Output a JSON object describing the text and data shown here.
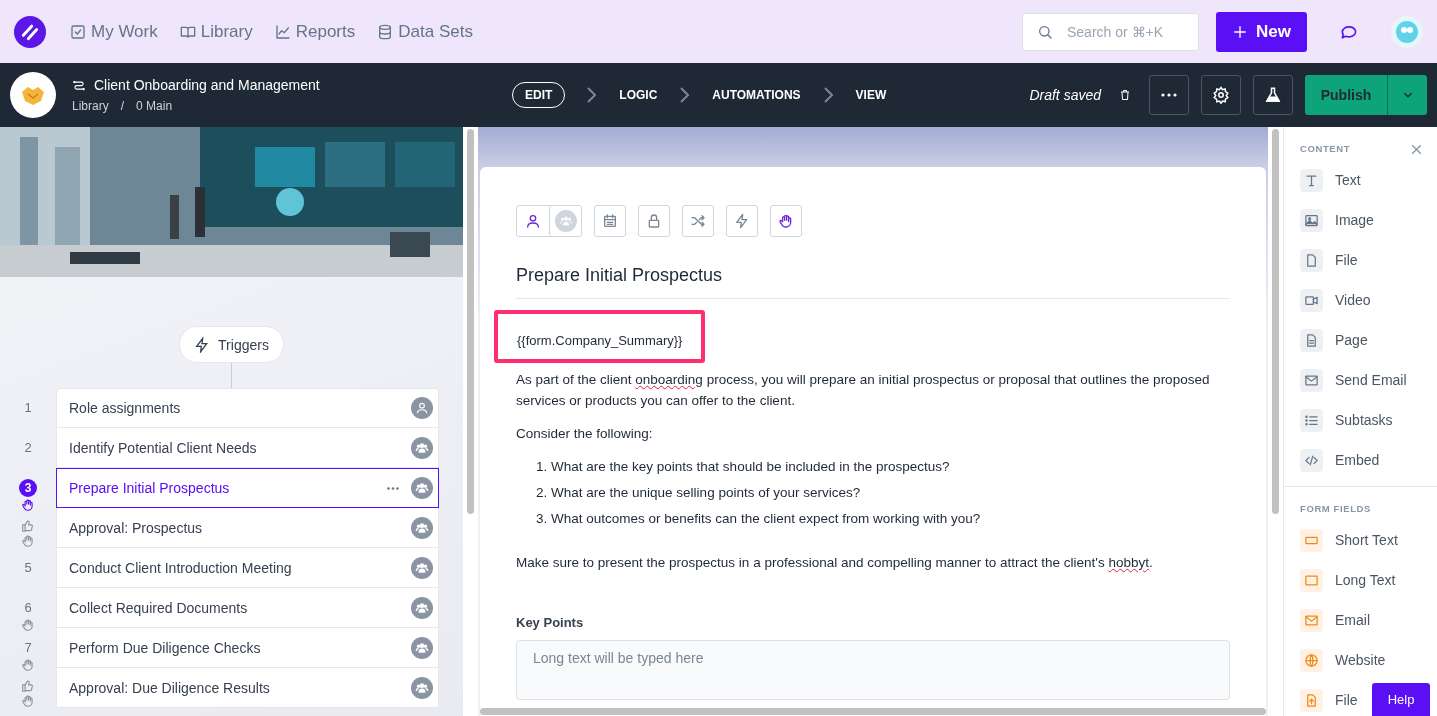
{
  "top_nav": {
    "items": [
      {
        "label": "My Work"
      },
      {
        "label": "Library"
      },
      {
        "label": "Reports"
      },
      {
        "label": "Data Sets"
      }
    ],
    "search": {
      "placeholder": "Search or ⌘+K"
    },
    "new_button": "New"
  },
  "workflow_bar": {
    "title": "Client Onboarding and Management",
    "breadcrumb": [
      "Library",
      "/",
      "0 Main"
    ],
    "steps": [
      {
        "label": "EDIT",
        "selected": true
      },
      {
        "label": "LOGIC",
        "selected": false
      },
      {
        "label": "AUTOMATIONS",
        "selected": false
      },
      {
        "label": "VIEW",
        "selected": false
      }
    ],
    "status": "Draft saved",
    "publish": "Publish"
  },
  "left_panel": {
    "triggers": "Triggers",
    "tasks": [
      {
        "number": "1",
        "kind": "task",
        "stop": false,
        "title": "Role assignments",
        "group": false,
        "selected": false
      },
      {
        "number": "2",
        "kind": "task",
        "stop": false,
        "title": "Identify Potential Client Needs",
        "group": true,
        "selected": false
      },
      {
        "number": "3",
        "kind": "task",
        "stop": true,
        "title": "Prepare Initial Prospectus",
        "group": true,
        "selected": true
      },
      {
        "kind": "approval",
        "stop": true,
        "title": "Approval: Prospectus",
        "group": true,
        "selected": false
      },
      {
        "number": "5",
        "kind": "task",
        "stop": false,
        "title": "Conduct Client Introduction Meeting",
        "group": true,
        "selected": false
      },
      {
        "number": "6",
        "kind": "task",
        "stop": true,
        "title": "Collect Required Documents",
        "group": true,
        "selected": false
      },
      {
        "number": "7",
        "kind": "task",
        "stop": true,
        "title": "Perform Due Diligence Checks",
        "group": true,
        "selected": false
      },
      {
        "kind": "approval",
        "stop": true,
        "title": "Approval: Due Diligence Results",
        "group": true,
        "selected": false
      }
    ]
  },
  "editor": {
    "title": "Prepare Initial Prospectus",
    "variable": "{{form.Company_Summary}}",
    "intro": [
      {
        "text": "As part of the client "
      },
      {
        "text": "onboarding",
        "misspelled": true
      },
      {
        "text": " process, you will prepare an initial prospectus or proposal that outlines the proposed services or products you can offer to the client."
      }
    ],
    "lead": "Consider the following:",
    "list": [
      {
        "number": "1.",
        "text": "What are the key points that should be included in the prospectus?"
      },
      {
        "number": "2.",
        "text": "What are the unique selling points of your services?"
      },
      {
        "number": "3.",
        "text": "What outcomes or benefits can the client expect from working with you?"
      }
    ],
    "closing": [
      {
        "text": "Make sure to present the prospectus in a professional and compelling manner to attract the client's "
      },
      {
        "text": "hobbyt",
        "misspelled": true
      },
      {
        "text": "."
      }
    ],
    "field": {
      "label": "Key Points",
      "placeholder": "Long text will be typed here"
    }
  },
  "right_panel": {
    "sections": [
      {
        "heading": "CONTENT",
        "kind": "content",
        "items": [
          {
            "label": "Text"
          },
          {
            "label": "Image"
          },
          {
            "label": "File"
          },
          {
            "label": "Video"
          },
          {
            "label": "Page"
          },
          {
            "label": "Send Email"
          },
          {
            "label": "Subtasks"
          },
          {
            "label": "Embed"
          }
        ]
      },
      {
        "heading": "FORM FIELDS",
        "kind": "field",
        "items": [
          {
            "label": "Short Text"
          },
          {
            "label": "Long Text"
          },
          {
            "label": "Email"
          },
          {
            "label": "Website"
          },
          {
            "label": "File"
          }
        ]
      }
    ]
  },
  "help": "Help"
}
